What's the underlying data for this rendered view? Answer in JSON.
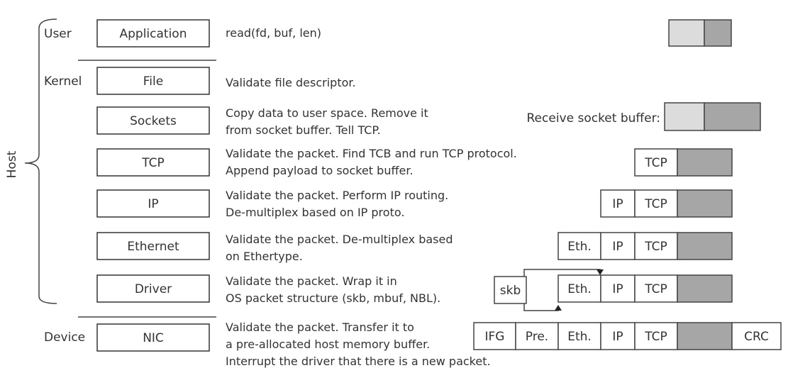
{
  "host_label": "Host",
  "scopes": {
    "user": "User",
    "kernel": "Kernel",
    "device": "Device"
  },
  "layers": [
    {
      "name": "Application",
      "desc": [
        "read(fd, buf, len)"
      ]
    },
    {
      "name": "File",
      "desc": [
        "Validate file descriptor."
      ]
    },
    {
      "name": "Sockets",
      "desc": [
        "Copy data to user space. Remove it",
        "from socket buffer. Tell TCP."
      ]
    },
    {
      "name": "TCP",
      "desc": [
        "Validate the packet. Find TCB and run TCP protocol.",
        "Append payload to socket buffer."
      ]
    },
    {
      "name": "IP",
      "desc": [
        "Validate the packet. Perform IP routing.",
        "De-multiplex based on IP proto."
      ]
    },
    {
      "name": "Ethernet",
      "desc": [
        "Validate the packet. De-multiplex based",
        "on Ethertype."
      ]
    },
    {
      "name": "Driver",
      "desc": [
        "Validate the packet. Wrap it in",
        "OS packet structure (skb, mbuf, NBL)."
      ]
    },
    {
      "name": "NIC",
      "desc": [
        "Validate the packet. Transfer it to",
        "a pre-allocated host memory buffer.",
        "Interrupt the driver that there is a new packet."
      ]
    }
  ],
  "receive_socket_buffer_label": "Receive socket buffer:",
  "fields": {
    "skb": "skb",
    "eth": "Eth.",
    "ip": "IP",
    "tcp": "TCP",
    "ifg": "IFG",
    "pre": "Pre.",
    "crc": "CRC"
  },
  "colors": {
    "payload": "#a6a6a6",
    "consumed": "#dcdcdc",
    "stroke": "#444444"
  }
}
